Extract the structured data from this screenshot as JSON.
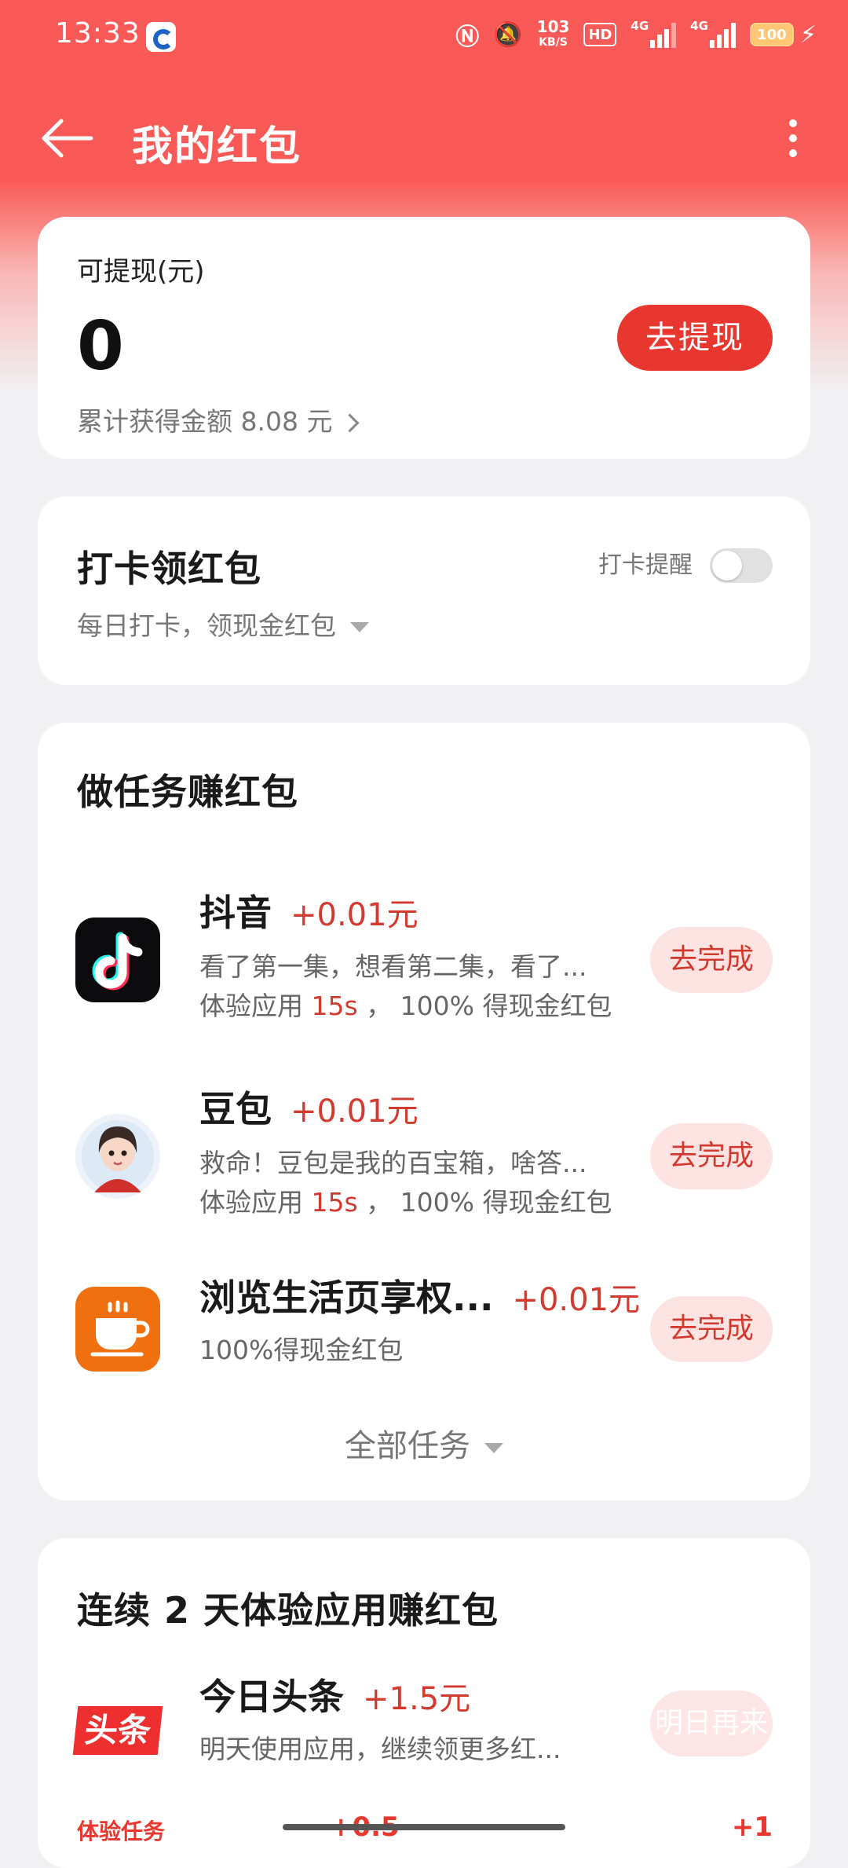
{
  "status": {
    "time": "13:33",
    "speed_value": "103",
    "speed_unit": "KB/S",
    "hd": "HD",
    "sig1": "4G",
    "sig2": "4G",
    "battery": "100"
  },
  "appbar": {
    "title": "我的红包"
  },
  "withdraw": {
    "label": "可提现(元)",
    "amount": "0",
    "cumulative": "累计获得金额 8.08 元",
    "button": "去提现"
  },
  "checkin": {
    "title": "打卡领红包",
    "subtitle": "每日打卡，领现金红包",
    "reminder_label": "打卡提醒",
    "reminder_on": false
  },
  "tasks": {
    "title": "做任务赚红包",
    "items": [
      {
        "name": "抖音",
        "reward": "+0.01元",
        "desc": "看了第一集，想看第二集，看了...",
        "exp_pre": "体验应用 ",
        "exp_time": "15s",
        "exp_post": " ， 100% 得现金红包",
        "button": "去完成",
        "icon": "tiktok-icon"
      },
      {
        "name": "豆包",
        "reward": "+0.01元",
        "desc": "救命！豆包是我的百宝箱，啥答...",
        "exp_pre": "体验应用 ",
        "exp_time": "15s",
        "exp_post": " ， 100% 得现金红包",
        "button": "去完成",
        "icon": "doubao-avatar-icon"
      },
      {
        "name": "浏览生活页享权...",
        "reward": "+0.01元",
        "desc": "100%得现金红包",
        "button": "去完成",
        "icon": "coffee-cup-icon"
      }
    ],
    "all_tasks": "全部任务"
  },
  "streak": {
    "title": "连续 2 天体验应用赚红包",
    "item": {
      "name": "今日头条",
      "reward": "+1.5元",
      "desc": "明天使用应用，继续领更多红...",
      "button": "明日再来",
      "icon_text": "头条"
    },
    "footer_left": "体验任务",
    "footer_mid": "+0.5",
    "footer_right": "+1"
  },
  "colors": {
    "accent": "#e8372f",
    "reward_red": "#d23a30",
    "header": "#f95a57",
    "background": "#f1f1f3"
  }
}
